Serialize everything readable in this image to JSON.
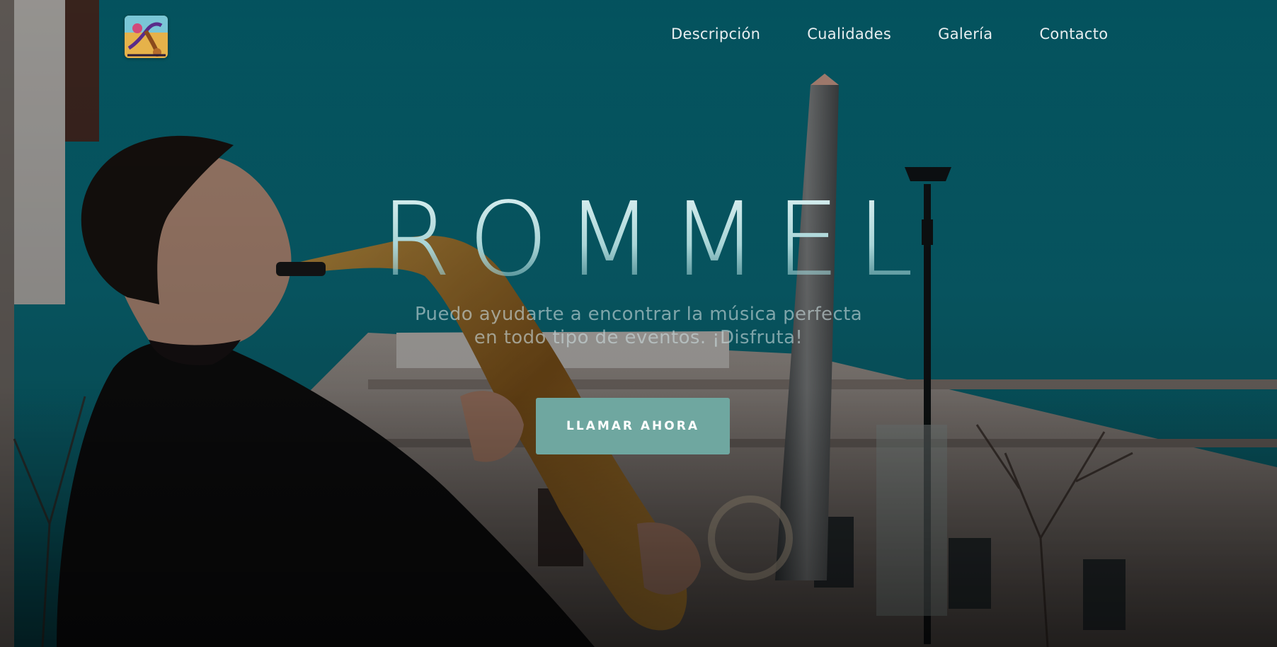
{
  "brand": {
    "logo_icon": "saxophone-logo-icon"
  },
  "nav": {
    "items": [
      {
        "label": "Descripción"
      },
      {
        "label": "Cualidades"
      },
      {
        "label": "Galería"
      },
      {
        "label": "Contacto"
      }
    ]
  },
  "hero": {
    "title": "ROMMEL",
    "subtitle_line1": "Puedo ayudarte a encontrar la música perfecta",
    "subtitle_line2": "en todo tipo de eventos. ¡Disfruta!",
    "cta_label": "LLAMAR AHORA",
    "background": "saxophonist-street-photo"
  },
  "colors": {
    "sky": "#0a7384",
    "cta": "#6fa7a0",
    "nav_text": "#e8eef0",
    "title": "#cdeaeb"
  }
}
